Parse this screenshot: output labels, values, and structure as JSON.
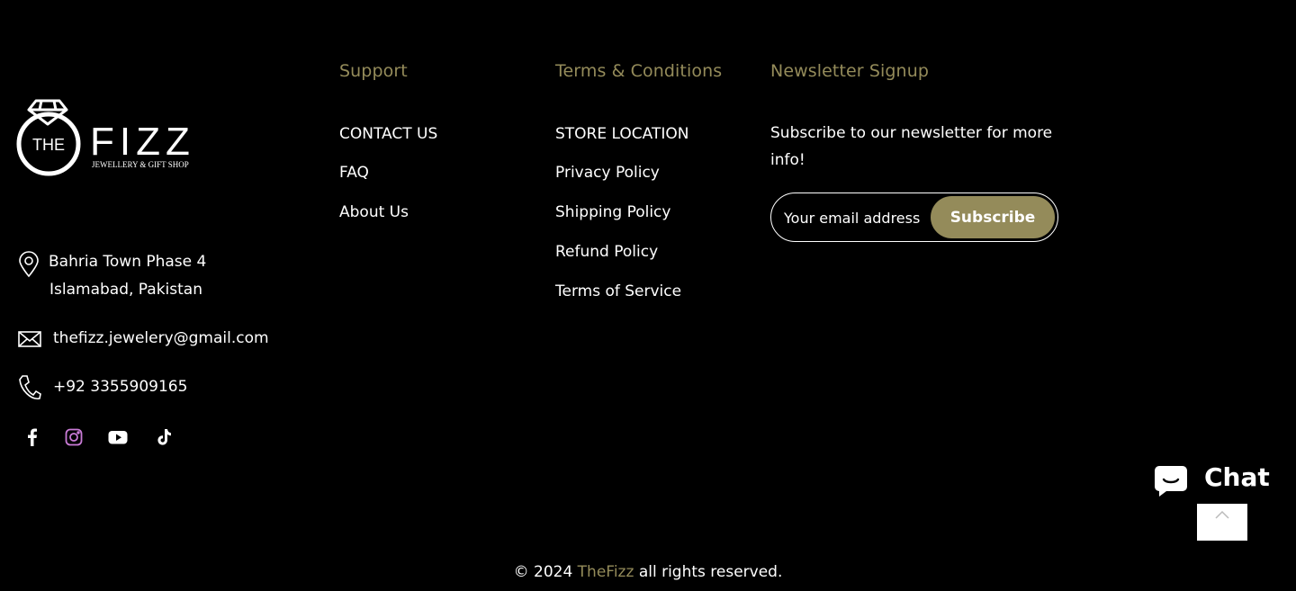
{
  "logo": {
    "ring_text": "THE",
    "name": "FIZZ",
    "tagline": "JEWELLERY & GIFT SHOP"
  },
  "contact": {
    "address_line1": "Bahria Town Phase 4",
    "address_line2": "Islamabad, Pakistan",
    "email": "thefizz.jewelery@gmail.com",
    "phone": "+92 3355909165",
    "icons": [
      "location-pin-icon",
      "envelope-icon",
      "phone-icon"
    ]
  },
  "social": {
    "icons": [
      "facebook-icon",
      "instagram-icon",
      "youtube-icon",
      "tiktok-icon"
    ]
  },
  "support": {
    "title": "Support",
    "links": [
      "CONTACT US",
      "FAQ",
      "About Us"
    ]
  },
  "terms": {
    "title": "Terms & Conditions",
    "links": [
      "STORE LOCATION",
      "Privacy Policy",
      "Shipping Policy",
      "Refund Policy",
      "Terms of Service"
    ]
  },
  "newsletter": {
    "title": "Newsletter Signup",
    "text": "Subscribe to our newsletter for more info!",
    "placeholder": "Your email address",
    "button_label": "Subscribe"
  },
  "chat": {
    "label": "Chat"
  },
  "footer": {
    "copyright_prefix": "© 2024",
    "brand": "TheFizz",
    "copyright_suffix": "all rights reserved."
  },
  "colors": {
    "background": "#000000",
    "accent": "#948b5a",
    "text": "#ffffff"
  }
}
